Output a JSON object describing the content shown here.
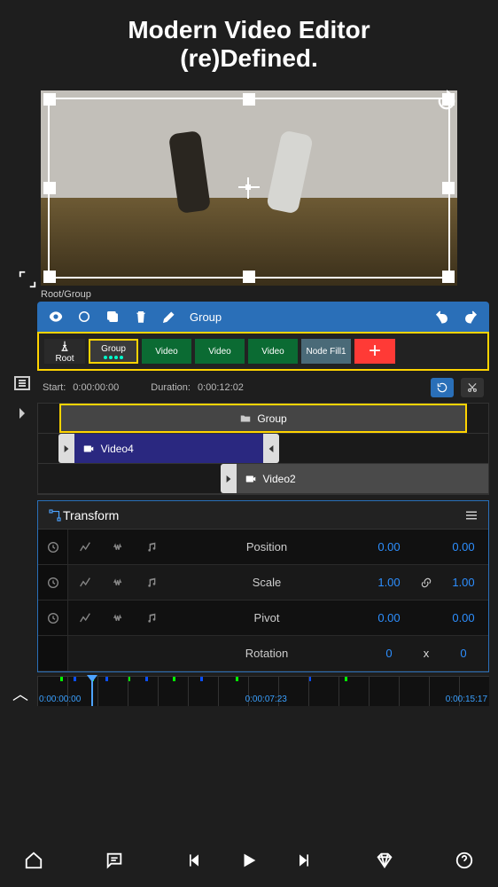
{
  "hero": {
    "line1": "Modern Video Editor",
    "line2": "(re)Defined."
  },
  "breadcrumb": "Root/Group",
  "bluebar": {
    "group_label": "Group"
  },
  "layers": {
    "root": "Root",
    "group": "Group",
    "thumbs": [
      "Video",
      "Video",
      "Video",
      "Node Fill1"
    ]
  },
  "timing": {
    "start_label": "Start:",
    "start_value": "0:00:00:00",
    "duration_label": "Duration:",
    "duration_value": "0:00:12:02"
  },
  "clips": {
    "group": "Group",
    "video4": "Video4",
    "video2": "Video2"
  },
  "transform": {
    "title": "Transform",
    "rows": [
      {
        "label": "Position",
        "a": "0.00",
        "b": "0.00",
        "link": false
      },
      {
        "label": "Scale",
        "a": "1.00",
        "b": "1.00",
        "link": true
      },
      {
        "label": "Pivot",
        "a": "0.00",
        "b": "0.00",
        "link": false
      },
      {
        "label": "Rotation",
        "a": "0",
        "mid": "x",
        "b": "0",
        "link": false
      }
    ]
  },
  "ruler": {
    "t0": "0:00:00:00",
    "t1": "0:00:07:23",
    "t2": "0:00:15:17"
  }
}
